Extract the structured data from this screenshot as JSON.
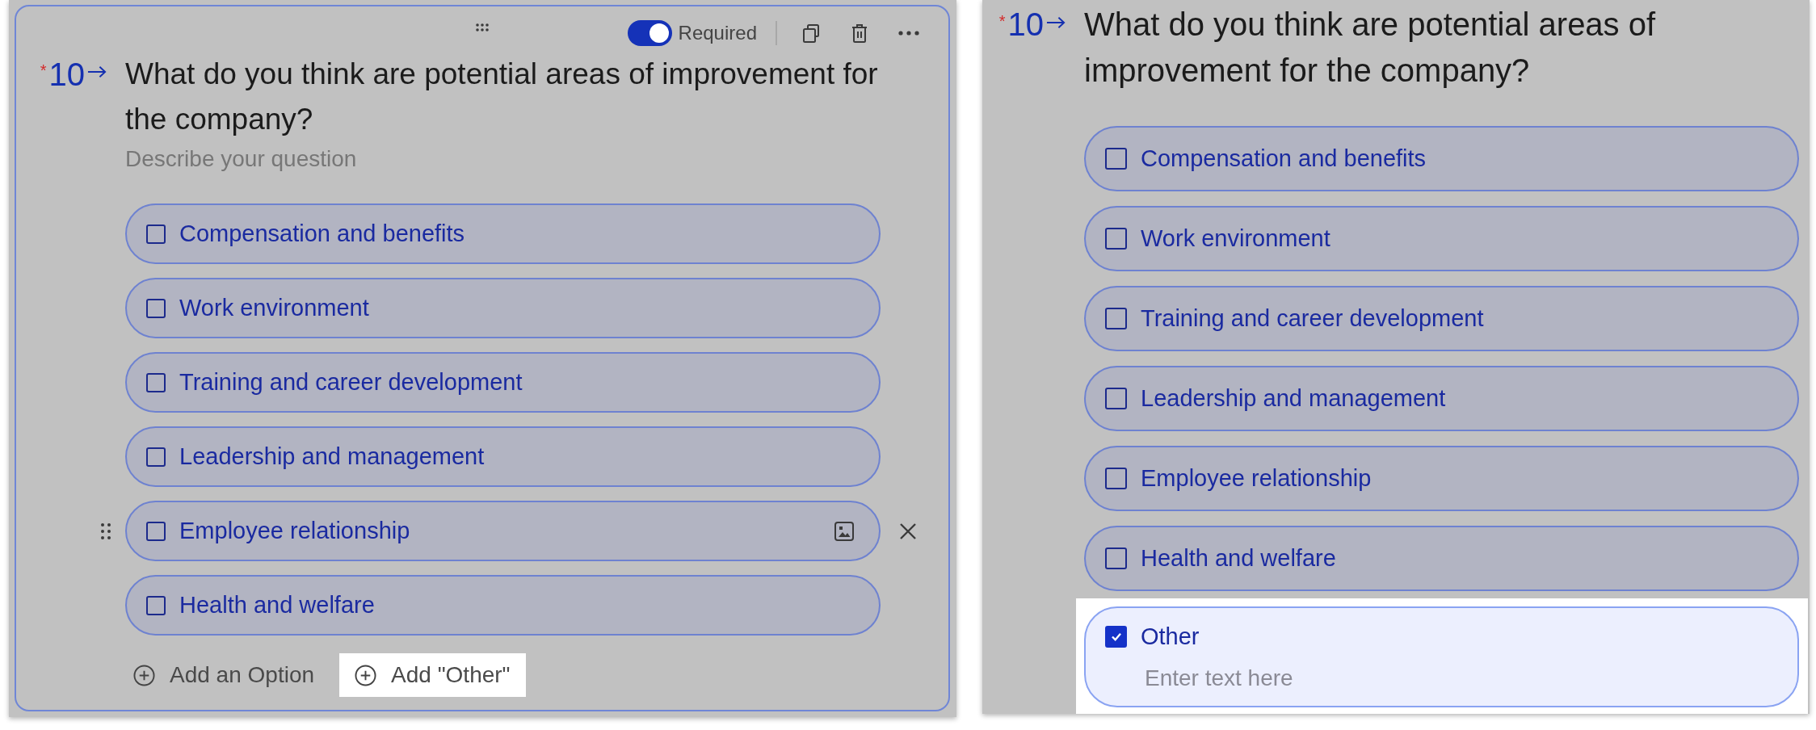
{
  "editor": {
    "toolbar": {
      "required": {
        "label": "Required",
        "on": true
      }
    },
    "question": {
      "required_mark": "*",
      "number": "10",
      "title": "What do you think are potential areas of improvement for the company?",
      "description": {
        "placeholder": "Describe your question"
      }
    },
    "options": [
      {
        "label": "Compensation and benefits",
        "checked": false,
        "hovered": false
      },
      {
        "label": "Work environment",
        "checked": false,
        "hovered": false
      },
      {
        "label": "Training and career development",
        "checked": false,
        "hovered": false
      },
      {
        "label": "Leadership and management",
        "checked": false,
        "hovered": false
      },
      {
        "label": "Employee relationship",
        "checked": false,
        "hovered": true
      },
      {
        "label": "Health and welfare",
        "checked": false,
        "hovered": false
      }
    ],
    "actions": [
      {
        "label": "Add an Option",
        "highlighted": false
      },
      {
        "label": "Add \"Other\"",
        "highlighted": true
      }
    ]
  },
  "preview": {
    "question": {
      "required_mark": "*",
      "number": "10",
      "title": "What do you think are potential areas of improvement for the company?"
    },
    "options": [
      {
        "kind": "choice",
        "label": "Compensation and benefits",
        "checked": false,
        "highlighted": false
      },
      {
        "kind": "choice",
        "label": "Work environment",
        "checked": false,
        "highlighted": false
      },
      {
        "kind": "choice",
        "label": "Training and career development",
        "checked": false,
        "highlighted": false
      },
      {
        "kind": "choice",
        "label": "Leadership and management",
        "checked": false,
        "highlighted": false
      },
      {
        "kind": "choice",
        "label": "Employee relationship",
        "checked": false,
        "highlighted": false
      },
      {
        "kind": "choice",
        "label": "Health and welfare",
        "checked": false,
        "highlighted": false
      },
      {
        "kind": "other",
        "label": "Other",
        "checked": true,
        "highlighted": true,
        "placeholder": "Enter text here"
      }
    ]
  }
}
